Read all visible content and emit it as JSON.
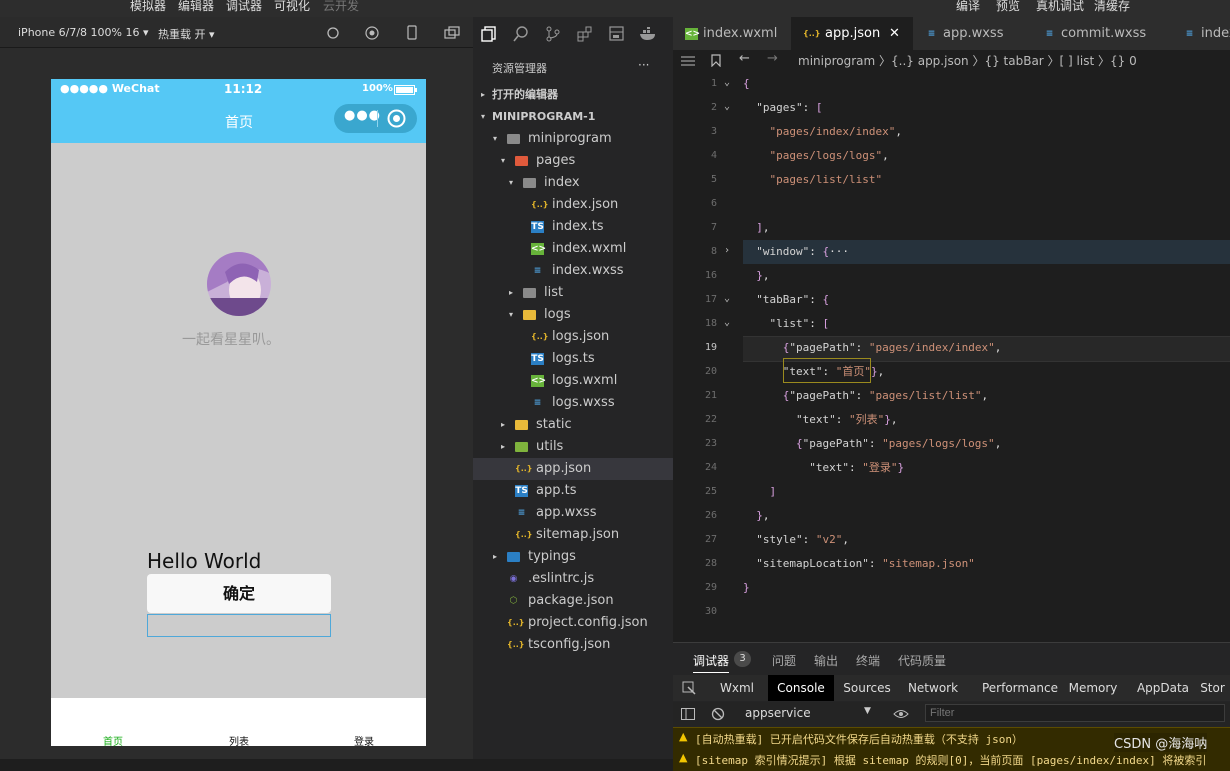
{
  "topbar": {
    "items": [
      "模拟器",
      "编辑器",
      "调试器",
      "可视化",
      "云开发",
      "编译",
      "预览",
      "真机调试",
      "清缓存"
    ]
  },
  "simulator": {
    "device": "iPhone 6/7/8 100% 16 ▾",
    "hot_reload": "热重载 开 ▾",
    "status": {
      "carrier": "●●●●● WeChat",
      "time": "11:12",
      "battery": "100%"
    },
    "nav_title": "首页",
    "nickname": "一起看星星叭。",
    "hello": "Hello World",
    "confirm": "确定",
    "tabs": [
      "首页",
      "列表",
      "登录"
    ]
  },
  "explorer": {
    "title": "资源管理器",
    "more": "···",
    "open_editors": "打开的编辑器",
    "project": "MINIPROGRAM-1",
    "tree": [
      {
        "name": "miniprogram",
        "type": "folder-open",
        "depth": 1,
        "chev": "▾"
      },
      {
        "name": "pages",
        "type": "folder-red",
        "depth": 2,
        "chev": "▾"
      },
      {
        "name": "index",
        "type": "folder-open",
        "depth": 3,
        "chev": "▾"
      },
      {
        "name": "index.json",
        "type": "json",
        "depth": 4
      },
      {
        "name": "index.ts",
        "type": "ts",
        "depth": 4
      },
      {
        "name": "index.wxml",
        "type": "wxml",
        "depth": 4
      },
      {
        "name": "index.wxss",
        "type": "wxss",
        "depth": 4
      },
      {
        "name": "list",
        "type": "folder",
        "depth": 3,
        "chev": "▸"
      },
      {
        "name": "logs",
        "type": "folder-yellow",
        "depth": 3,
        "chev": "▾"
      },
      {
        "name": "logs.json",
        "type": "json",
        "depth": 4
      },
      {
        "name": "logs.ts",
        "type": "ts",
        "depth": 4
      },
      {
        "name": "logs.wxml",
        "type": "wxml",
        "depth": 4
      },
      {
        "name": "logs.wxss",
        "type": "wxss",
        "depth": 4
      },
      {
        "name": "static",
        "type": "folder-yellow",
        "depth": 2,
        "chev": "▸"
      },
      {
        "name": "utils",
        "type": "folder-green",
        "depth": 2,
        "chev": "▸"
      },
      {
        "name": "app.json",
        "type": "json",
        "depth": 2,
        "active": true
      },
      {
        "name": "app.ts",
        "type": "ts",
        "depth": 2
      },
      {
        "name": "app.wxss",
        "type": "wxss",
        "depth": 2
      },
      {
        "name": "sitemap.json",
        "type": "json",
        "depth": 2
      },
      {
        "name": "typings",
        "type": "folder-ts",
        "depth": 1,
        "chev": "▸"
      },
      {
        "name": ".eslintrc.js",
        "type": "eslint",
        "depth": 1
      },
      {
        "name": "package.json",
        "type": "pkg",
        "depth": 1
      },
      {
        "name": "project.config.json",
        "type": "json",
        "depth": 1
      },
      {
        "name": "tsconfig.json",
        "type": "json",
        "depth": 1
      }
    ]
  },
  "editor": {
    "tabs": [
      {
        "label": "index.wxml",
        "icon": "wxml"
      },
      {
        "label": "app.json",
        "icon": "json",
        "active": true,
        "close": "✕"
      },
      {
        "label": "app.wxss",
        "icon": "wxss"
      },
      {
        "label": "commit.wxss",
        "icon": "wxss"
      },
      {
        "label": "index",
        "icon": "wxss"
      }
    ],
    "breadcrumb": "miniprogram 〉{..} app.json 〉{} tabBar 〉[ ] list 〉{} 0",
    "lines": [
      {
        "n": "1",
        "t": "{"
      },
      {
        "n": "2",
        "t": "  \"pages\": ["
      },
      {
        "n": "3",
        "t": "    \"pages/index/index\","
      },
      {
        "n": "4",
        "t": "    \"pages/logs/logs\","
      },
      {
        "n": "5",
        "t": "    \"pages/list/list\""
      },
      {
        "n": "6",
        "t": ""
      },
      {
        "n": "7",
        "t": "  ],"
      },
      {
        "n": "8",
        "t": "  \"window\": {···"
      },
      {
        "n": "16",
        "t": "  },"
      },
      {
        "n": "17",
        "t": "  \"tabBar\": {"
      },
      {
        "n": "18",
        "t": "    \"list\": ["
      },
      {
        "n": "19",
        "t": "      {\"pagePath\": \"pages/index/index\","
      },
      {
        "n": "20",
        "t": "      \"text\": \"首页\"},"
      },
      {
        "n": "21",
        "t": "      {\"pagePath\": \"pages/list/list\","
      },
      {
        "n": "22",
        "t": "        \"text\": \"列表\"},"
      },
      {
        "n": "23",
        "t": "        {\"pagePath\": \"pages/logs/logs\","
      },
      {
        "n": "24",
        "t": "          \"text\": \"登录\"}"
      },
      {
        "n": "25",
        "t": "    ]"
      },
      {
        "n": "26",
        "t": "  },"
      },
      {
        "n": "27",
        "t": "  \"style\": \"v2\","
      },
      {
        "n": "28",
        "t": "  \"sitemapLocation\": \"sitemap.json\""
      },
      {
        "n": "29",
        "t": "}"
      },
      {
        "n": "30",
        "t": ""
      }
    ]
  },
  "debug": {
    "tabs": [
      "调试器",
      "问题",
      "输出",
      "终端",
      "代码质量"
    ],
    "badge": "3",
    "devtabs": [
      "Wxml",
      "Console",
      "Sources",
      "Network",
      "Performance",
      "Memory",
      "AppData",
      "Stor"
    ],
    "context": "appservice",
    "filter_placeholder": "Filter",
    "messages": [
      "[自动热重载] 已开启代码文件保存后自动热重载（不支持 json）",
      "[sitemap 索引情况提示] 根据 sitemap 的规则[0]，当前页面 [pages/index/index] 将被索引"
    ],
    "watermark": "CSDN @海海呐"
  }
}
